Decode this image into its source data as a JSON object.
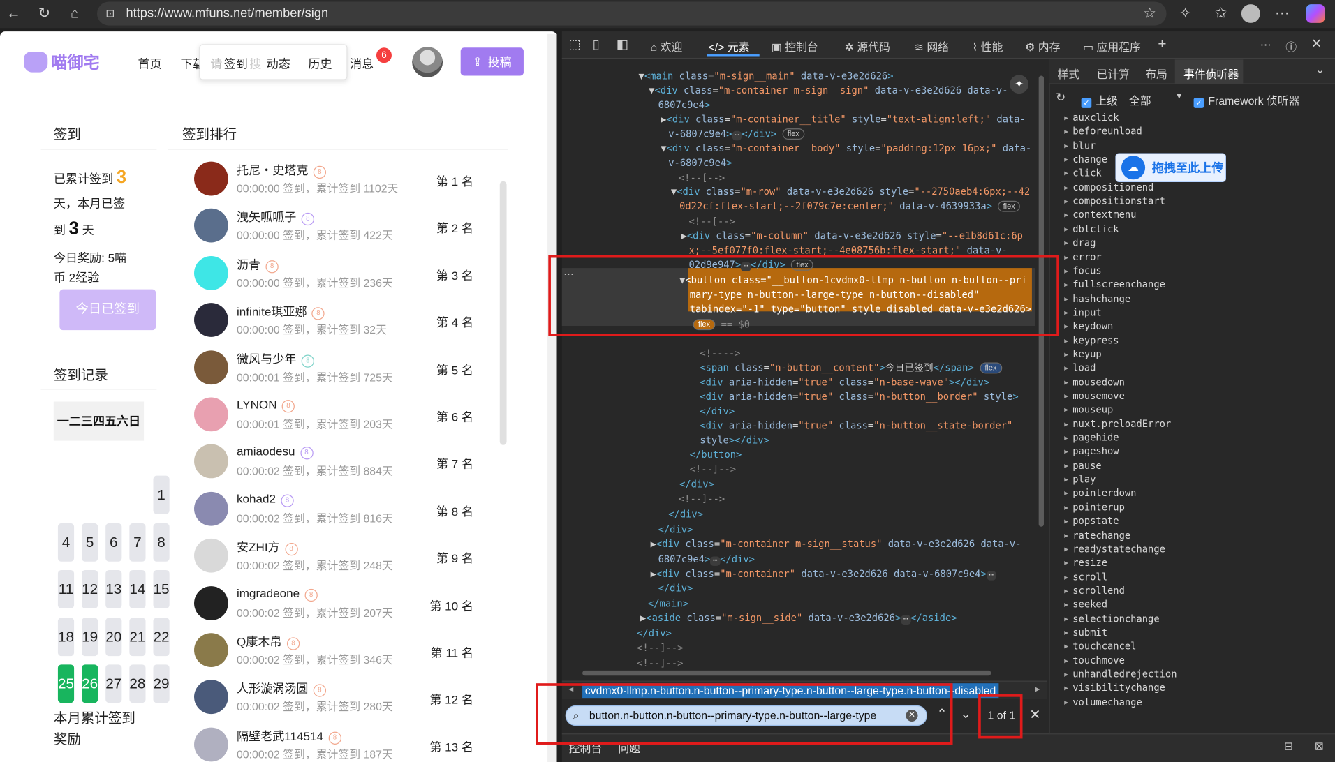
{
  "browser": {
    "url": "https://www.mfuns.net/member/sign"
  },
  "site": {
    "logo_text": "喵御宅",
    "nav": [
      "首页",
      "下载",
      "动态",
      "历史",
      "消息"
    ],
    "popup": {
      "placeholder": "请",
      "item1": "签到",
      "item2": "搜"
    },
    "message_badge": "6",
    "post_button": "投稿"
  },
  "sign_panel": {
    "title": "签到",
    "cumulative_prefix": "已累计签到",
    "cumulative_days": "3",
    "cumulative_suffix": "天，本月已签",
    "month_prefix": "到",
    "month_days": "3",
    "month_suffix": "天",
    "reward_line1": "今日奖励:   5喵",
    "reward_line2": "币  2经验",
    "signed_button": "今日已签到",
    "record_title": "签到记录",
    "weekdays": "一二三四五六日",
    "month_total_line1": "本月累计签到",
    "month_total_line2": "奖励",
    "calendar": [
      {
        "day": "1",
        "signed": false
      },
      {
        "day": "4",
        "signed": false
      },
      {
        "day": "5",
        "signed": false
      },
      {
        "day": "6",
        "signed": false
      },
      {
        "day": "7",
        "signed": false
      },
      {
        "day": "8",
        "signed": false
      },
      {
        "day": "11",
        "signed": false
      },
      {
        "day": "12",
        "signed": false
      },
      {
        "day": "13",
        "signed": false
      },
      {
        "day": "14",
        "signed": false
      },
      {
        "day": "15",
        "signed": false
      },
      {
        "day": "18",
        "signed": false
      },
      {
        "day": "19",
        "signed": false
      },
      {
        "day": "20",
        "signed": false
      },
      {
        "day": "21",
        "signed": false
      },
      {
        "day": "22",
        "signed": false
      },
      {
        "day": "25",
        "signed": true
      },
      {
        "day": "26",
        "signed": true
      },
      {
        "day": "27",
        "signed": false
      },
      {
        "day": "28",
        "signed": false
      },
      {
        "day": "29",
        "signed": false
      }
    ]
  },
  "ranking": {
    "title": "签到排行",
    "rows": [
      {
        "name": "托尼・史塔克",
        "level": "8",
        "sub": "00:00:00 签到，累计签到 1102天",
        "rank": "第 1 名",
        "color": "#8a2a1a"
      },
      {
        "name": "洩矢呱呱子",
        "level": "8",
        "sub": "00:00:00 签到，累计签到 422天",
        "rank": "第 2 名",
        "color": "#5a6e8c"
      },
      {
        "name": "沥青",
        "level": "8",
        "sub": "00:00:00 签到，累计签到 236天",
        "rank": "第 3 名",
        "color": "#3ee6e6"
      },
      {
        "name": "infinite琪亚娜",
        "level": "8",
        "sub": "00:00:00 签到，累计签到 32天",
        "rank": "第 4 名",
        "color": "#2a2a3a"
      },
      {
        "name": "微风与少年",
        "level": "8",
        "sub": "00:00:01 签到，累计签到 725天",
        "rank": "第 5 名",
        "color": "#7a5a3a"
      },
      {
        "name": "LYNON",
        "level": "8",
        "sub": "00:00:01 签到，累计签到 203天",
        "rank": "第 6 名",
        "color": "#e8a0b0"
      },
      {
        "name": "amiaodesu",
        "level": "8",
        "sub": "00:00:02 签到，累计签到 884天",
        "rank": "第 7 名",
        "color": "#c9c0b0"
      },
      {
        "name": "kohad2",
        "level": "8",
        "sub": "00:00:02 签到，累计签到 816天",
        "rank": "第 8 名",
        "color": "#8a8ab0"
      },
      {
        "name": "安ZHI方",
        "level": "8",
        "sub": "00:00:02 签到，累计签到 248天",
        "rank": "第 9 名",
        "color": "#d9d9d9"
      },
      {
        "name": "imgradeone",
        "level": "8",
        "sub": "00:00:02 签到，累计签到 207天",
        "rank": "第 10 名",
        "color": "#222222"
      },
      {
        "name": "Q康木帛",
        "level": "8",
        "sub": "00:00:02 签到，累计签到 346天",
        "rank": "第 11 名",
        "color": "#8a7a4a"
      },
      {
        "name": "人形漩涡汤圆",
        "level": "8",
        "sub": "00:00:02 签到，累计签到 280天",
        "rank": "第 12 名",
        "color": "#4a5a7a"
      },
      {
        "name": "隔壁老武114514",
        "level": "8",
        "sub": "00:00:02 签到，累计签到 187天",
        "rank": "第 13 名",
        "color": "#b0b0c0"
      }
    ]
  },
  "devtools": {
    "tabs": [
      "欢迎",
      "元素",
      "控制台",
      "源代码",
      "网络",
      "性能",
      "内存",
      "应用程序"
    ],
    "side_tabs": [
      "样式",
      "已计算",
      "布局",
      "事件侦听器"
    ],
    "ancestors_label": "上级",
    "all_label": "全部",
    "framework_label": "Framework 侦听器",
    "upload_overlay": "拖拽至此上传",
    "breadcrumb": "cvdmx0-llmp.n-button.n-button--primary-type.n-button--large-type.n-button--disabled",
    "search_query": "button.n-button.n-button--primary-type.n-button--large-type",
    "search_count": "1 of 1",
    "console_tabs": [
      "控制台",
      "问题"
    ],
    "events": [
      "auxclick",
      "beforeunload",
      "blur",
      "change",
      "click",
      "compositionend",
      "compositionstart",
      "contextmenu",
      "dblclick",
      "drag",
      "error",
      "focus",
      "fullscreenchange",
      "hashchange",
      "input",
      "keydown",
      "keypress",
      "keyup",
      "load",
      "mousedown",
      "mousemove",
      "mouseup",
      "nuxt.preloadError",
      "pagehide",
      "pageshow",
      "pause",
      "play",
      "pointerdown",
      "pointerup",
      "popstate",
      "ratechange",
      "readystatechange",
      "resize",
      "scroll",
      "scrollend",
      "seeked",
      "selectionchange",
      "submit",
      "touchcancel",
      "touchmove",
      "unhandledrejection",
      "visibilitychange",
      "volumechange"
    ]
  }
}
